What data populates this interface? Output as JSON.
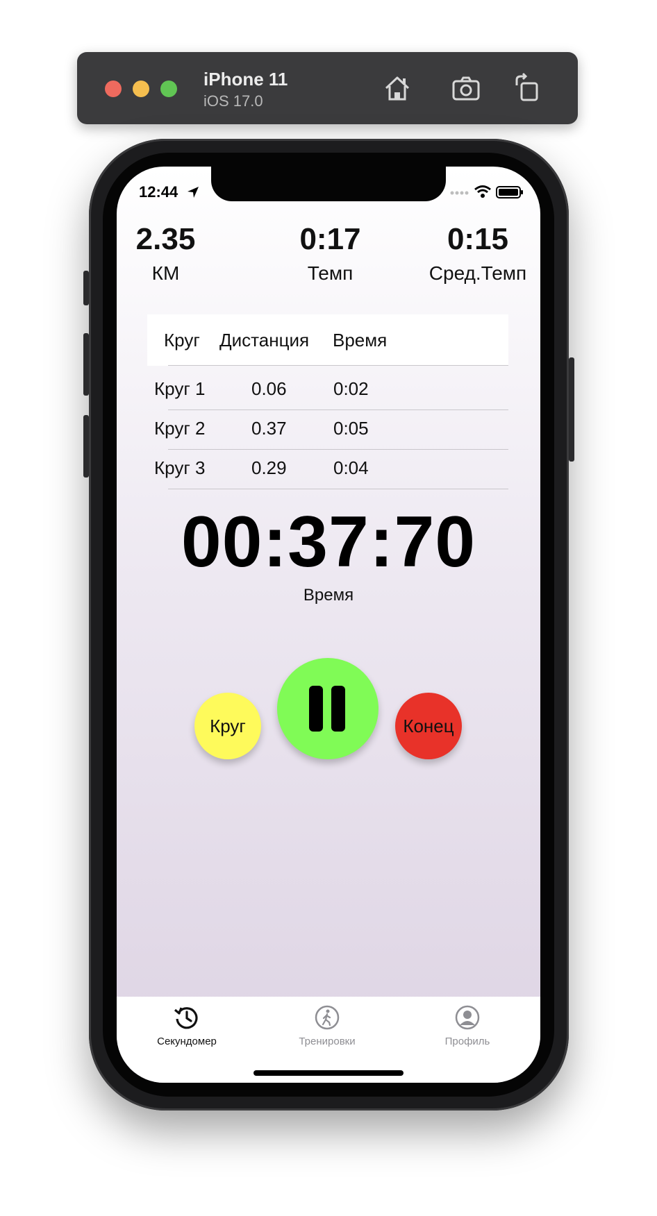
{
  "simulator": {
    "device_name": "iPhone 11",
    "os_version": "iOS 17.0",
    "toolbar_icons": [
      "home-icon",
      "screenshot-icon",
      "rotate-icon"
    ]
  },
  "status_bar": {
    "time": "12:44",
    "icons": [
      "location-icon",
      "signal-icon",
      "wifi-icon",
      "battery-icon"
    ]
  },
  "stats": {
    "distance": {
      "value": "2.35",
      "label": "КМ"
    },
    "pace": {
      "value": "0:17",
      "label": "Темп"
    },
    "avg_pace": {
      "value": "0:15",
      "label": "Сред.Темп"
    }
  },
  "laps": {
    "headers": [
      "Круг",
      "Дистанция",
      "Время"
    ],
    "rows": [
      {
        "lap": "Круг 1",
        "distance": "0.06",
        "time": "0:02"
      },
      {
        "lap": "Круг 2",
        "distance": "0.37",
        "time": "0:05"
      },
      {
        "lap": "Круг 3",
        "distance": "0.29",
        "time": "0:04"
      }
    ]
  },
  "timer": {
    "value": "00:37:70",
    "label": "Время"
  },
  "controls": {
    "lap_label": "Круг",
    "end_label": "Конец",
    "pause_icon": "pause-icon",
    "colors": {
      "lap": "#fefa5b",
      "pause": "#80fb56",
      "end": "#e83229"
    }
  },
  "tabbar": {
    "tabs": [
      {
        "label": "Секундомер",
        "icon": "stopwatch-history-icon",
        "active": true
      },
      {
        "label": "Тренировки",
        "icon": "walking-person-icon",
        "active": false
      },
      {
        "label": "Профиль",
        "icon": "profile-icon",
        "active": false
      }
    ]
  }
}
